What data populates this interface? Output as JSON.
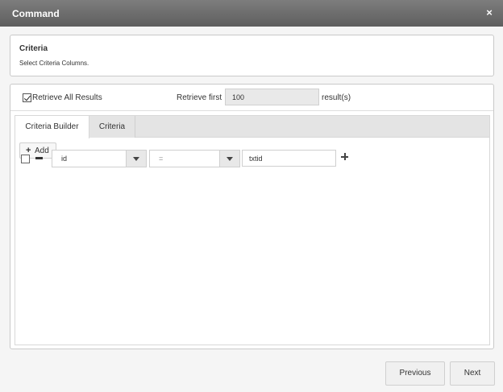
{
  "window": {
    "title": "Command",
    "close_glyph": "×"
  },
  "criteria": {
    "heading": "Criteria",
    "description": "Select Criteria Columns."
  },
  "retrieve": {
    "all_label": "Retrieve All Results",
    "all_checked": true,
    "first_label": "Retrieve first",
    "count_value": "100",
    "results_label": "result(s)"
  },
  "tabs": [
    {
      "label": "Criteria Builder",
      "active": true
    },
    {
      "label": "Criteria",
      "active": false
    }
  ],
  "builder": {
    "add_label": "Add",
    "rows": [
      {
        "checked": false,
        "field": "id",
        "operator": "=",
        "value": "txtid"
      }
    ]
  },
  "footer": {
    "previous_label": "Previous",
    "next_label": "Next"
  },
  "icons": {
    "close": "close-icon",
    "add": "plus-icon",
    "remove_row": "minus-icon",
    "add_row": "plus-icon",
    "dropdown": "chevron-down-icon"
  }
}
